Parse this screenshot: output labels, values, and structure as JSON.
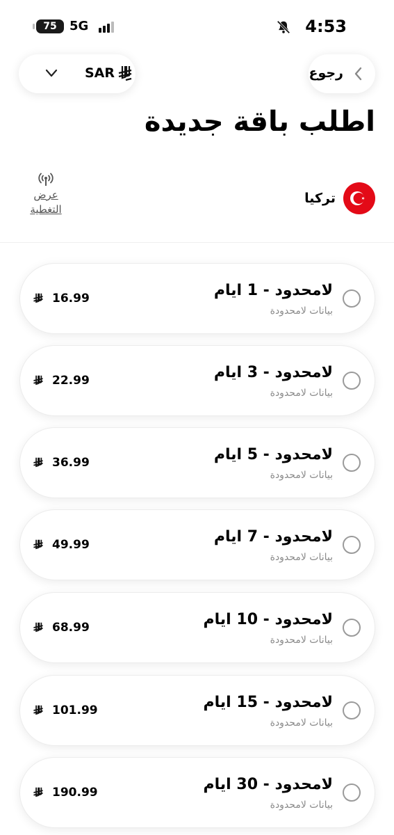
{
  "status_bar": {
    "time": "4:53",
    "battery": "75",
    "network": "5G"
  },
  "header": {
    "currency_code": "SAR",
    "back_label": "رجوع"
  },
  "title": "اطلب باقة جديدة",
  "country": {
    "name": "تركيا"
  },
  "coverage": {
    "label_line1": "عرض",
    "label_line2": "التغطية"
  },
  "plans": [
    {
      "name": "لامحدود - 1 ايام",
      "desc": "بيانات لامحدودة",
      "price": "16.99"
    },
    {
      "name": "لامحدود - 3 ايام",
      "desc": "بيانات لامحدودة",
      "price": "22.99"
    },
    {
      "name": "لامحدود - 5 ايام",
      "desc": "بيانات لامحدودة",
      "price": "36.99"
    },
    {
      "name": "لامحدود - 7 ايام",
      "desc": "بيانات لامحدودة",
      "price": "49.99"
    },
    {
      "name": "لامحدود - 10 ايام",
      "desc": "بيانات لامحدودة",
      "price": "68.99"
    },
    {
      "name": "لامحدود - 15 ايام",
      "desc": "بيانات لامحدودة",
      "price": "101.99"
    },
    {
      "name": "لامحدود - 30 ايام",
      "desc": "بيانات لامحدودة",
      "price": "190.99"
    }
  ],
  "colors": {
    "flag_red": "#e30a17",
    "radio_border": "#9a9a9a",
    "muted_text": "#8a8a8a"
  }
}
